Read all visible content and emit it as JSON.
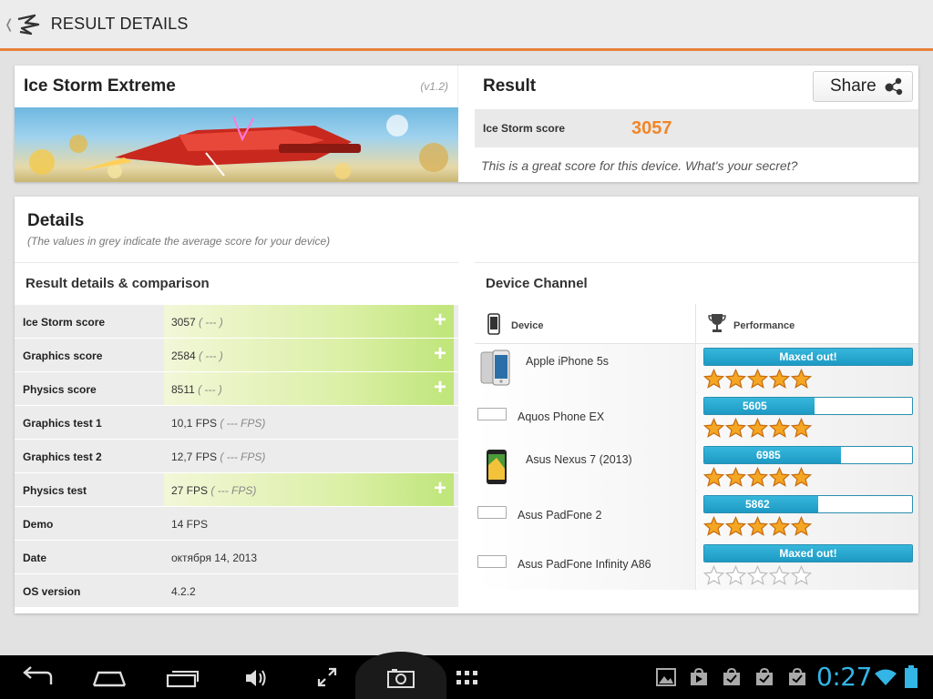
{
  "topbar": {
    "title": "RESULT DETAILS"
  },
  "benchmark": {
    "name": "Ice Storm Extreme",
    "version": "(v1.2)"
  },
  "result": {
    "title": "Result",
    "share_label": "Share",
    "score_label": "Ice Storm score",
    "score_value": "3057",
    "message": "This is a great score for this device. What's your secret?"
  },
  "details": {
    "title": "Details",
    "subtitle": "(The values in grey indicate the average score for your device)",
    "comparison_title": "Result details & comparison",
    "rows": [
      {
        "label": "Ice Storm score",
        "value": "3057",
        "avg": "( --- )",
        "highlight": true
      },
      {
        "label": "Graphics score",
        "value": "2584",
        "avg": "( --- )",
        "highlight": true
      },
      {
        "label": "Physics score",
        "value": "8511",
        "avg": "( --- )",
        "highlight": true
      },
      {
        "label": "Graphics test 1",
        "value": "10,1 FPS",
        "avg": "( --- FPS)",
        "highlight": false
      },
      {
        "label": "Graphics test 2",
        "value": "12,7 FPS",
        "avg": "( --- FPS)",
        "highlight": false
      },
      {
        "label": "Physics test",
        "value": "27 FPS",
        "avg": "( --- FPS)",
        "highlight": true
      },
      {
        "label": "Demo",
        "value": "14 FPS",
        "avg": "",
        "highlight": false
      },
      {
        "label": "Date",
        "value": "октября 14, 2013",
        "avg": "",
        "highlight": false
      },
      {
        "label": "OS version",
        "value": "4.2.2",
        "avg": "",
        "highlight": false
      }
    ]
  },
  "channel": {
    "title": "Device Channel",
    "col_device": "Device",
    "col_performance": "Performance",
    "devices": [
      {
        "name": "Apple iPhone 5s",
        "bar_label": "Maxed out!",
        "fill": 1.0,
        "stars": 5,
        "thumb": "iphone"
      },
      {
        "name": "Aquos Phone EX",
        "bar_label": "5605",
        "fill": 0.53,
        "stars": 5,
        "thumb": "empty"
      },
      {
        "name": "Asus Nexus 7 (2013)",
        "bar_label": "6985",
        "fill": 0.66,
        "stars": 5,
        "thumb": "nexus"
      },
      {
        "name": "Asus PadFone 2",
        "bar_label": "5862",
        "fill": 0.55,
        "stars": 5,
        "thumb": "empty"
      },
      {
        "name": "Asus PadFone Infinity A86",
        "bar_label": "Maxed out!",
        "fill": 1.0,
        "stars": 0,
        "thumb": "empty"
      }
    ]
  },
  "statusbar": {
    "time": "0:27"
  },
  "colors": {
    "accent": "#e8823a",
    "score": "#f0862a",
    "bar": "#1d9ac4",
    "clock": "#33b5e5"
  }
}
